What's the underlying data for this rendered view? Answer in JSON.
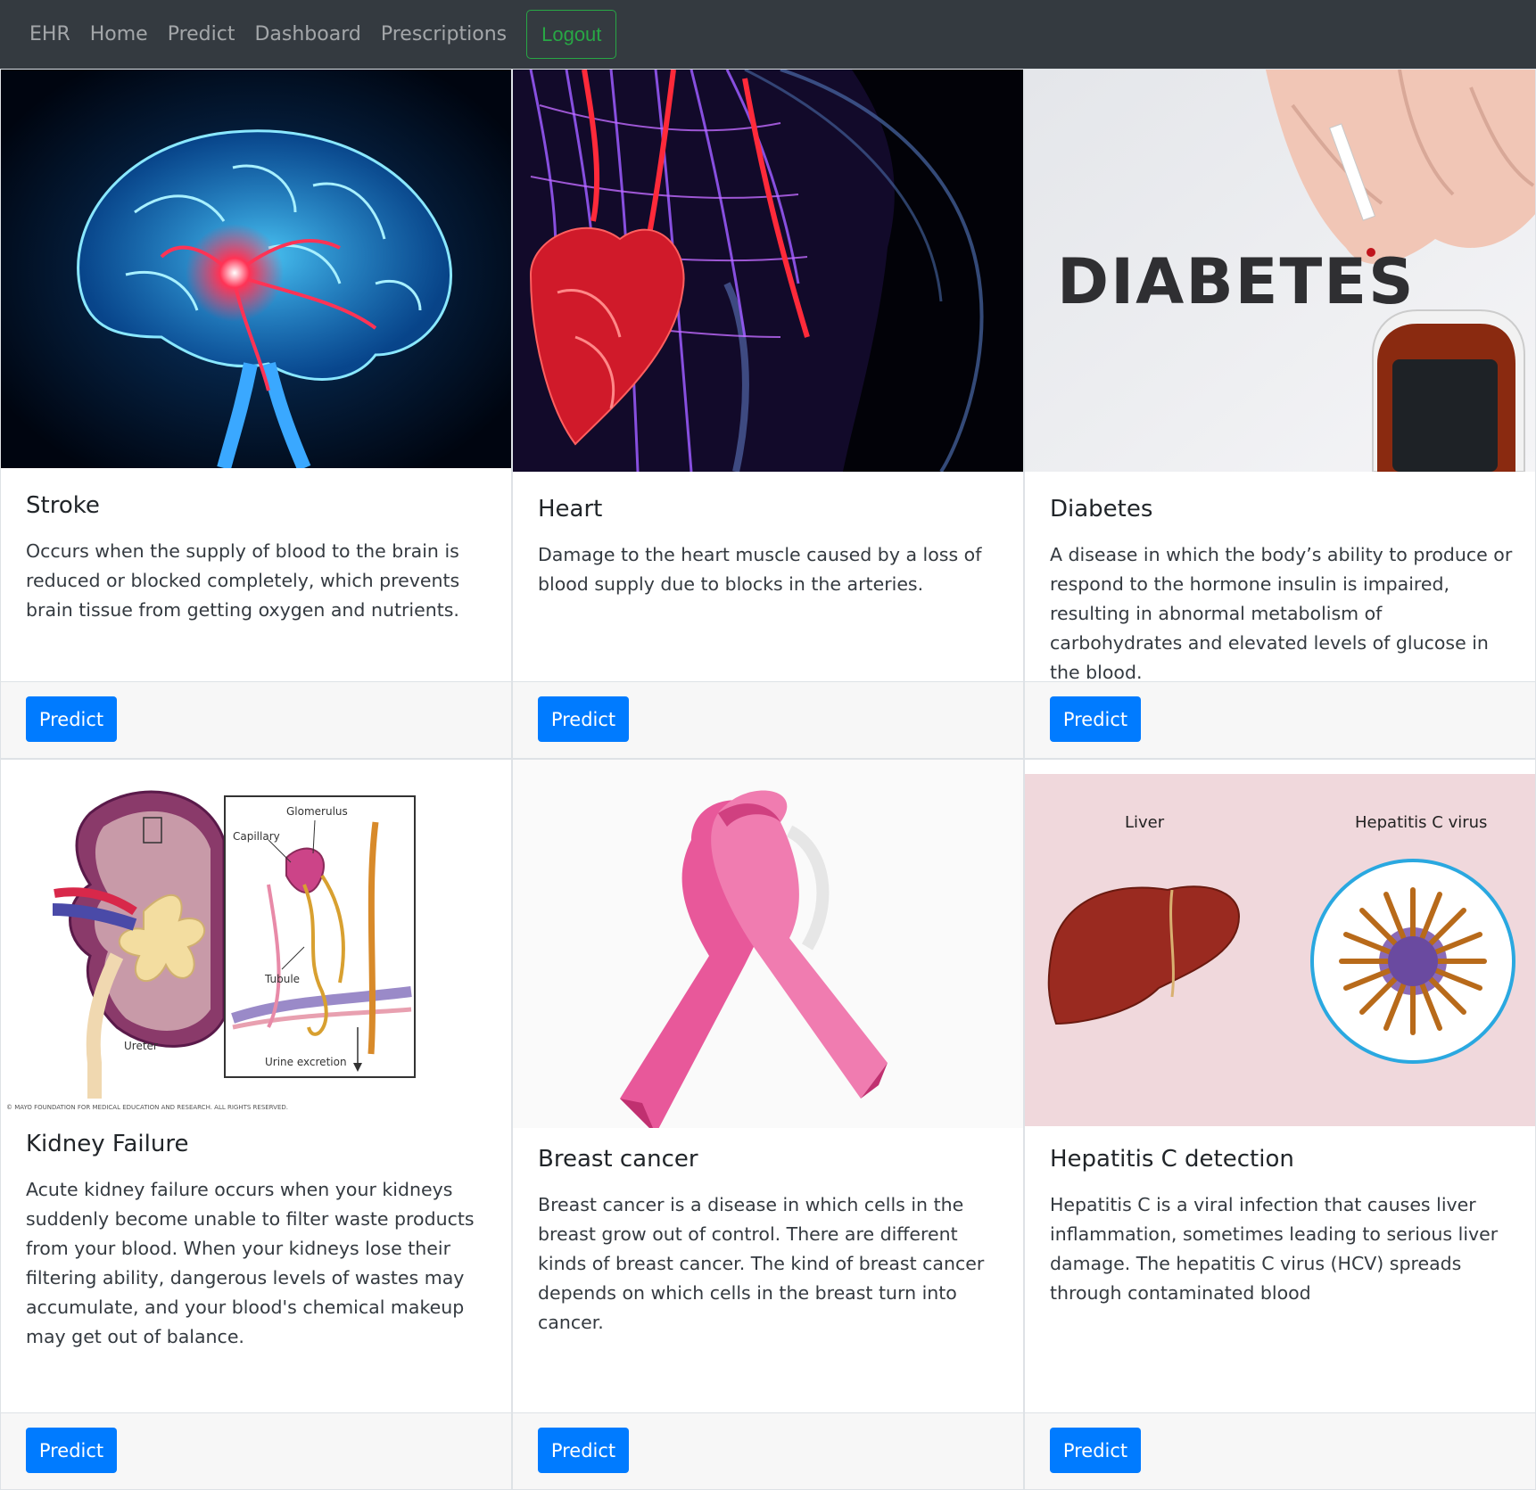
{
  "navbar": {
    "brand": "EHR",
    "links": [
      "Home",
      "Predict",
      "Dashboard",
      "Prescriptions"
    ],
    "logout_label": "Logout"
  },
  "cards": [
    {
      "title": "Stroke",
      "text": "Occurs when the supply of blood to the brain is reduced or blocked completely, which prevents brain tissue from getting oxygen and nutrients.",
      "button": "Predict",
      "image": "brain-illustration"
    },
    {
      "title": "Heart",
      "text": "Damage to the heart muscle caused by a loss of blood supply due to blocks in the arteries.",
      "button": "Predict",
      "image": "heart-vascular-illustration"
    },
    {
      "title": "Diabetes",
      "text": "A disease in which the body’s ability to produce or respond to the hormone insulin is impaired, resulting in abnormal metabolism of carbohydrates and elevated levels of glucose in the blood.",
      "button": "Predict",
      "image": "diabetes-test-photo",
      "image_text": "DIABETES"
    },
    {
      "title": "Kidney Failure",
      "text": "Acute kidney failure occurs when your kidneys suddenly become unable to filter waste products from your blood. When your kidneys lose their filtering ability, dangerous levels of wastes may accumulate, and your blood's chemical makeup may get out of balance.",
      "button": "Predict",
      "image": "kidney-diagram",
      "image_labels": {
        "glomerulus": "Glomerulus",
        "capillary": "Capillary",
        "tubule": "Tubule",
        "ureter": "Ureter",
        "urine": "Urine excretion",
        "copyright": "© MAYO FOUNDATION FOR MEDICAL EDUCATION AND RESEARCH. ALL RIGHTS RESERVED."
      }
    },
    {
      "title": "Breast cancer",
      "text": "Breast cancer is a disease in which cells in the breast grow out of control. There are different kinds of breast cancer. The kind of breast cancer depends on which cells in the breast turn into cancer.",
      "button": "Predict",
      "image": "pink-ribbon"
    },
    {
      "title": "Hepatitis C detection",
      "text": "Hepatitis C is a viral infection that causes liver inflammation, sometimes leading to serious liver damage. The hepatitis C virus (HCV) spreads through contaminated blood",
      "button": "Predict",
      "image": "liver-virus-illustration",
      "image_labels": {
        "liver": "Liver",
        "virus": "Hepatitis C virus"
      }
    }
  ],
  "colors": {
    "navbar_bg": "#343a40",
    "primary": "#007bff",
    "success": "#28a745",
    "footer_bg": "#f7f7f7"
  }
}
